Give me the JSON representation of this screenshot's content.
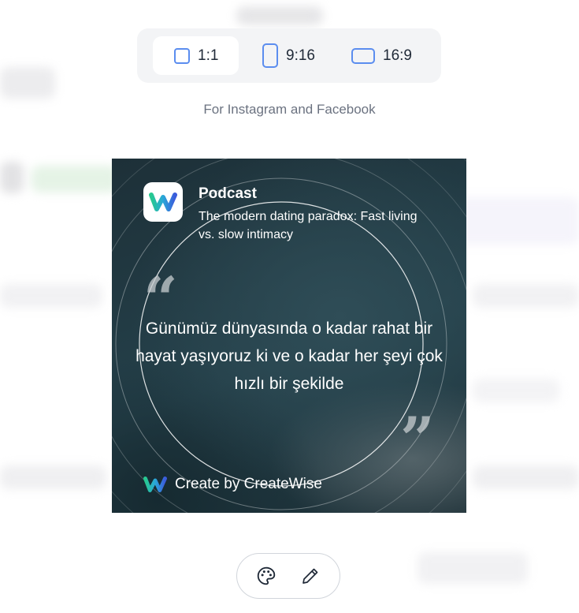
{
  "ratio_switcher": {
    "options": [
      {
        "label": "1:1",
        "icon": "square-ratio-icon",
        "selected": true
      },
      {
        "label": "9:16",
        "icon": "portrait-ratio-icon",
        "selected": false
      },
      {
        "label": "16:9",
        "icon": "landscape-ratio-icon",
        "selected": false
      }
    ],
    "accent_color": "#5b8def"
  },
  "subtitle": "For Instagram and Facebook",
  "card": {
    "label": "Podcast",
    "episode_title": "The modern dating paradox: Fast living vs. slow intimacy",
    "quote": "Günümüz dünyasında o kadar rahat bir hayat yaşıyoruz ki ve o kadar her şeyi çok hızlı bir şekilde",
    "footer": "Create by CreateWise",
    "logo_icon": "createwise-logo-icon"
  },
  "tools": [
    {
      "name": "palette-icon"
    },
    {
      "name": "pencil-icon"
    }
  ]
}
